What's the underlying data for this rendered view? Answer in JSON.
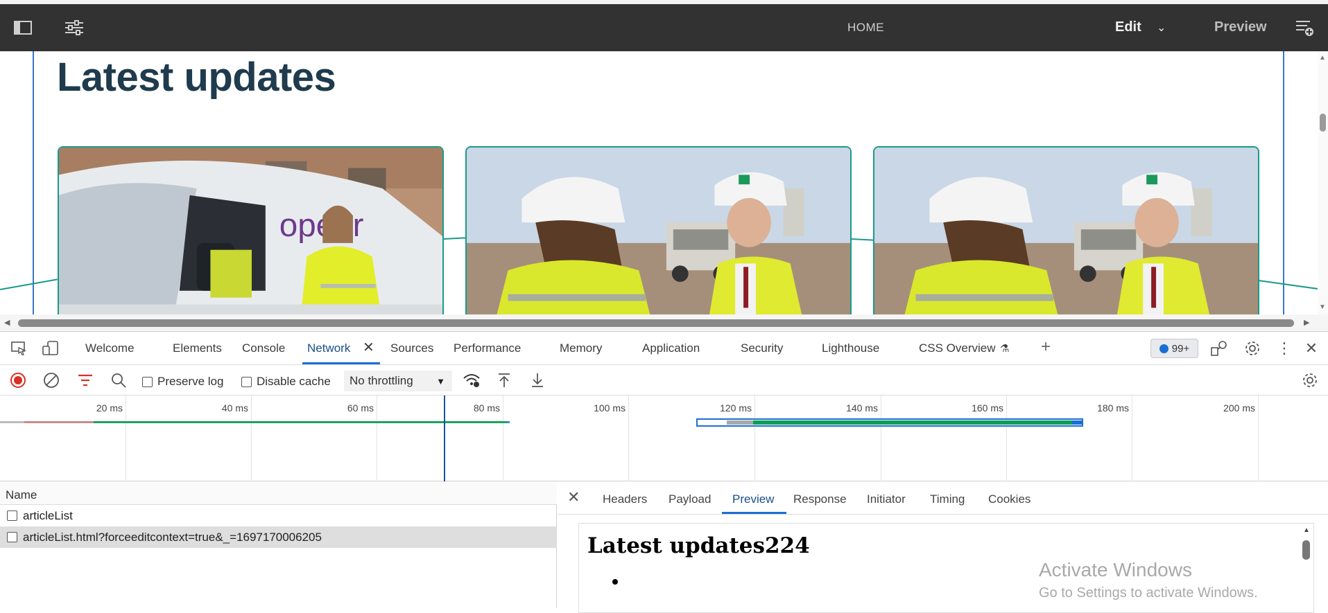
{
  "editor": {
    "home": "HOME",
    "edit": "Edit",
    "preview": "Preview"
  },
  "page": {
    "heading": "Latest updates",
    "cards": [
      {
        "alt": "Openreach van with engineer in hi-vis jacket"
      },
      {
        "alt": "Two workers in hard hats on a construction site"
      },
      {
        "alt": "Two workers in hard hats on a construction site"
      }
    ]
  },
  "devtools": {
    "tabs": [
      "Welcome",
      "Elements",
      "Console",
      "Network",
      "Sources",
      "Performance",
      "Memory",
      "Application",
      "Security",
      "Lighthouse",
      "CSS Overview"
    ],
    "active_tab": "Network",
    "issues_badge": "99+",
    "toolbar": {
      "preserve_log": "Preserve log",
      "disable_cache": "Disable cache",
      "throttling": "No throttling"
    },
    "timeline_ticks": [
      "20 ms",
      "40 ms",
      "60 ms",
      "80 ms",
      "100 ms",
      "120 ms",
      "140 ms",
      "160 ms",
      "180 ms",
      "200 ms"
    ],
    "requests": {
      "column_name": "Name",
      "rows": [
        "articleList",
        "articleList.html?forceeditcontext=true&_=1697170006205"
      ],
      "selected_index": 1
    },
    "details": {
      "tabs": [
        "Headers",
        "Payload",
        "Preview",
        "Response",
        "Initiator",
        "Timing",
        "Cookies"
      ],
      "active_tab": "Preview",
      "preview_heading": "Latest updates224"
    }
  },
  "watermark": {
    "line1": "Activate Windows",
    "line2": "Go to Settings to activate Windows."
  },
  "colors": {
    "editor_bar": "#323232",
    "heading": "#1f3b4d",
    "card_border": "#1a9a8a",
    "accent_blue": "#1a6fd4",
    "waterfall_green": "#0f9d58"
  }
}
